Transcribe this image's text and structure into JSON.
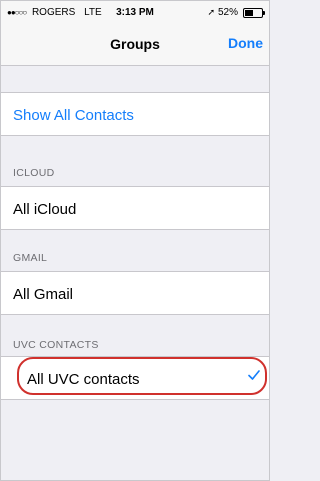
{
  "status_bar": {
    "signal_dots": "●●○○○",
    "carrier": "ROGERS",
    "network": "LTE",
    "time": "3:13 PM",
    "location_arrow": "➚",
    "battery_percent": "52%",
    "battery_level": 0.52
  },
  "nav": {
    "title": "Groups",
    "done_label": "Done"
  },
  "show_all": {
    "label": "Show All Contacts"
  },
  "sections": [
    {
      "header": "ICLOUD",
      "item": "All iCloud"
    },
    {
      "header": "GMAIL",
      "item": "All Gmail"
    },
    {
      "header": "UVC CONTACTS",
      "item": "All UVC contacts",
      "checked": true
    }
  ],
  "colors": {
    "accent": "#147efb",
    "highlight_ring": "#d0312d"
  },
  "icons": {
    "checkmark": "checkmark-icon",
    "location": "location-arrow-icon",
    "battery": "battery-icon"
  }
}
